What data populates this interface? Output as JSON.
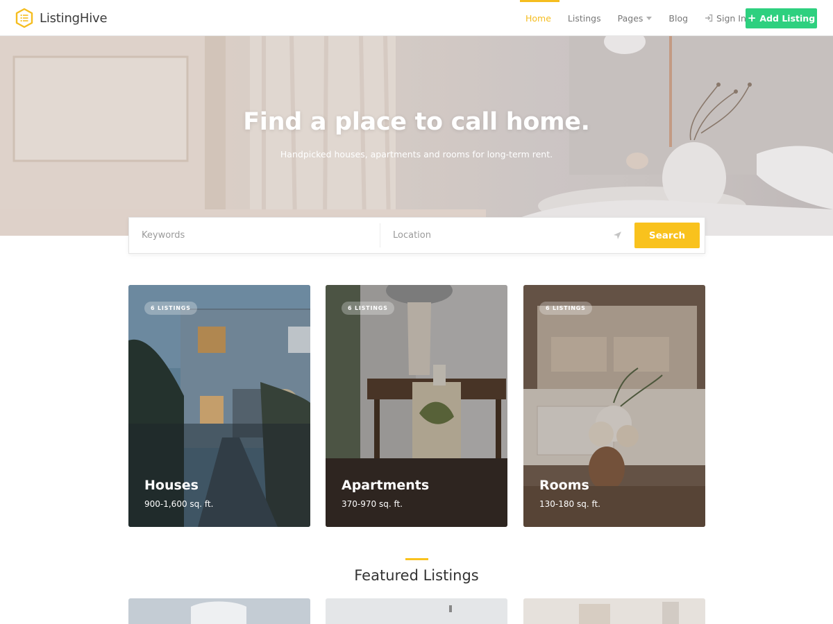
{
  "header": {
    "brand": "ListingHive",
    "nav": {
      "home": "Home",
      "listings": "Listings",
      "pages": "Pages",
      "blog": "Blog",
      "signin": "Sign In"
    },
    "add_listing": "Add Listing"
  },
  "hero": {
    "title": "Find a place to call home.",
    "subtitle": "Handpicked houses, apartments and rooms for long-term rent."
  },
  "search": {
    "keywords_placeholder": "Keywords",
    "location_placeholder": "Location",
    "button": "Search"
  },
  "categories": [
    {
      "badge": "6 LISTINGS",
      "title": "Houses",
      "size": "900-1,600 sq. ft."
    },
    {
      "badge": "6 LISTINGS",
      "title": "Apartments",
      "size": "370-970 sq. ft."
    },
    {
      "badge": "6 LISTINGS",
      "title": "Rooms",
      "size": "130-180 sq. ft."
    }
  ],
  "featured": {
    "title": "Featured Listings"
  },
  "colors": {
    "accent": "#f9c21d",
    "nav_active": "#f5bd1f",
    "add_button": "#2ed07f"
  },
  "icons": [
    "logo-hexagon-icon",
    "chevron-down-icon",
    "sign-in-icon",
    "plus-icon",
    "location-arrow-icon"
  ]
}
